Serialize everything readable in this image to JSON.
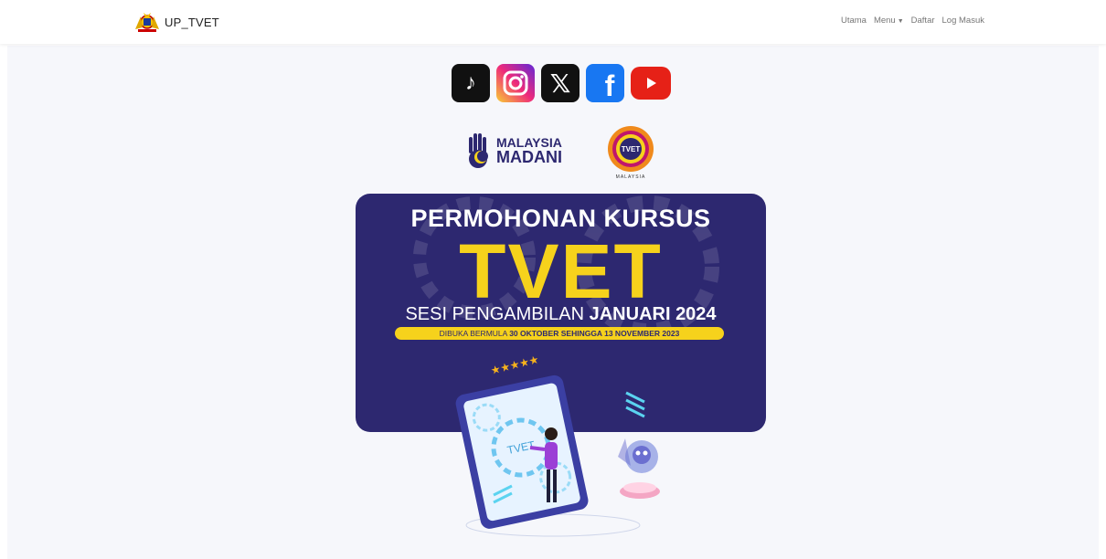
{
  "navbar": {
    "brand": "UP_TVET",
    "links": {
      "utama": "Utama",
      "menu": "Menu",
      "daftar": "Daftar",
      "log_masuk": "Log Masuk"
    }
  },
  "socials": {
    "tiktok": "tiktok-icon",
    "instagram": "instagram-icon",
    "x": "x-icon",
    "facebook": "facebook-icon",
    "youtube": "youtube-icon"
  },
  "logos": {
    "madani_line1": "MALAYSIA",
    "madani_line2": "MADANI",
    "tvet_badge": "TVET",
    "tvet_caption": "MALAYSIA"
  },
  "banner": {
    "title": "PERMOHONAN KURSUS",
    "big": "TVET",
    "sesi_prefix": "SESI PENGAMBILAN ",
    "sesi_bold": "JANUARI 2024",
    "pill_prefix": "DIBUKA BERMULA ",
    "pill_bold": "30 OKTOBER SEHINGGA 13 NOVEMBER 2023",
    "screen_label": "TVET"
  },
  "colors": {
    "banner_bg": "#2d2870",
    "accent_yellow": "#f6d21c"
  }
}
